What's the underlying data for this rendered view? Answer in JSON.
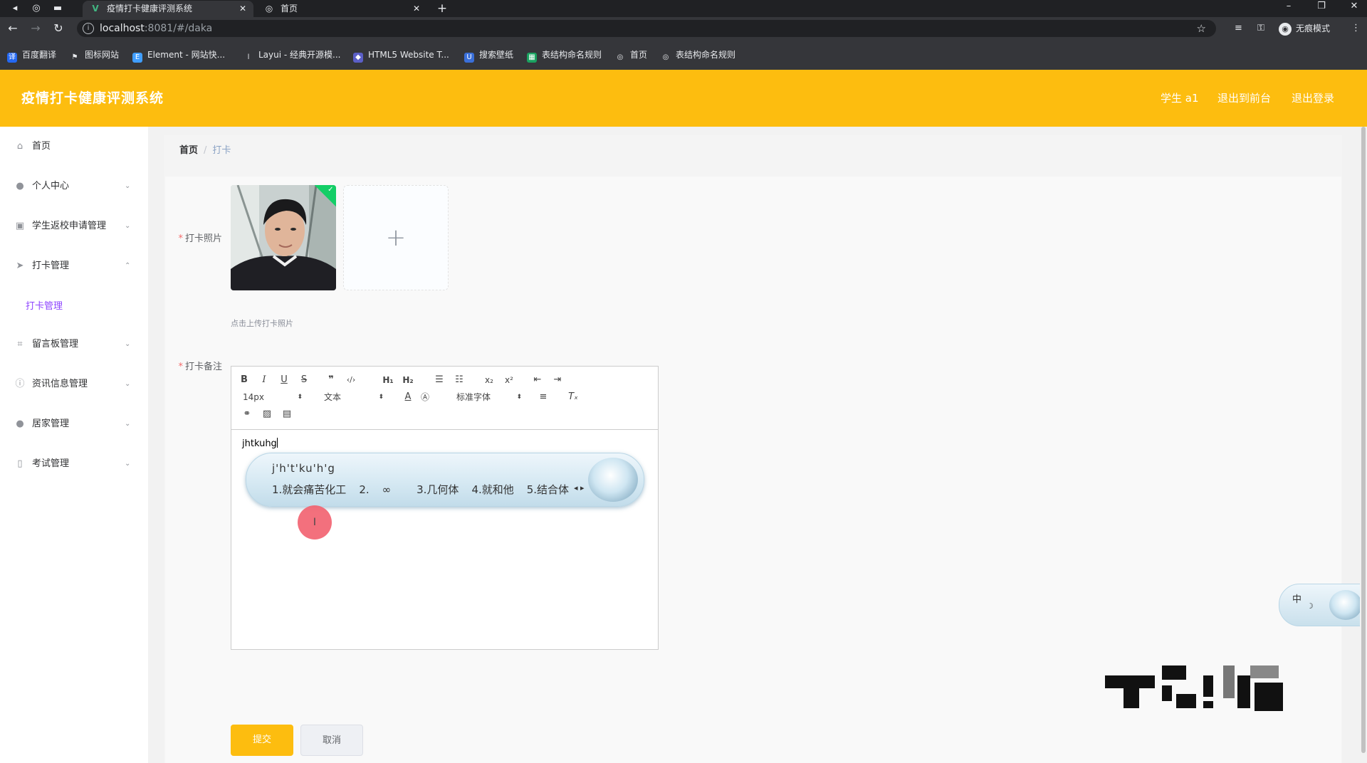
{
  "browser": {
    "tabs": [
      {
        "favicon": "vue-v-icon",
        "title": "疫情打卡健康评测系统",
        "active": true
      },
      {
        "favicon": "globe-icon",
        "title": "首页",
        "active": false
      }
    ],
    "url_host": "localhost",
    "url_path": ":8081/#/daka",
    "incognito_label": "无痕模式",
    "bookmarks": [
      "百度翻译",
      "图标网站",
      "Element - 网站快...",
      "Layui - 经典开源模...",
      "HTML5 Website T...",
      "搜索壁纸",
      "表结构命名规则",
      "首页",
      "表结构命名规则"
    ]
  },
  "header": {
    "app_title": "疫情打卡健康评测系统",
    "user": "学生 a1",
    "to_front": "退出到前台",
    "logout": "退出登录",
    "brand_color": "#fdbd0f"
  },
  "sidebar": {
    "items": [
      {
        "label": "首页",
        "icon": "home-icon"
      },
      {
        "label": "个人中心",
        "icon": "user-icon"
      },
      {
        "label": "学生返校申请管理",
        "icon": "clipboard-icon"
      },
      {
        "label": "打卡管理",
        "icon": "paper-plane-icon",
        "expanded": true
      },
      {
        "label": "留言板管理",
        "icon": "crop-icon"
      },
      {
        "label": "资讯信息管理",
        "icon": "info-icon"
      },
      {
        "label": "居家管理",
        "icon": "user-icon"
      },
      {
        "label": "考试管理",
        "icon": "phone-icon"
      }
    ],
    "subitem": "打卡管理",
    "accent_color": "#8e44ff"
  },
  "breadcrumb": {
    "home": "首页",
    "current": "打卡"
  },
  "form": {
    "photo_label": "打卡照片",
    "upload_tip": "点击上传打卡照片",
    "note_label": "打卡备注",
    "editor": {
      "font_size": "14px",
      "format": "文本",
      "font_family": "标准字体",
      "content": "jhtkuhg"
    },
    "submit": "提交",
    "cancel": "取消"
  },
  "ime": {
    "composition": "j'h't'ku'h'g",
    "candidates": [
      "1.就会痛苦化工",
      "2.",
      "3.几何体",
      "4.就和他",
      "5.结合体"
    ],
    "status": "中"
  }
}
